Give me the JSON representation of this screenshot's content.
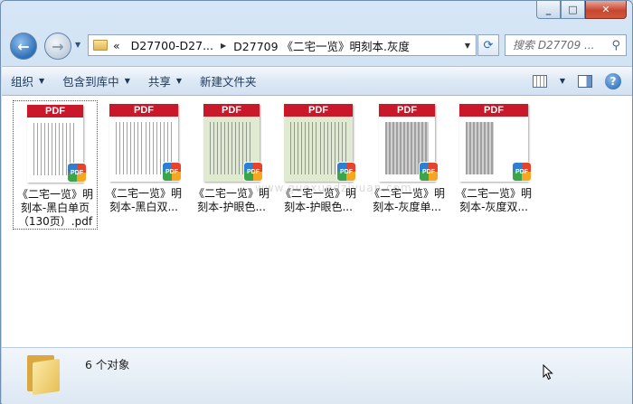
{
  "window": {
    "caption_buttons": [
      "minimize",
      "maximize",
      "close"
    ]
  },
  "nav": {
    "back_icon": "back-arrow-icon",
    "forward_icon": "forward-arrow-icon",
    "breadcrumb": {
      "overflow": "«",
      "items": [
        "D27700-D27...",
        "D27709 《二宅一览》明刻本.灰度"
      ]
    },
    "search_placeholder": "搜索 D27709 ..."
  },
  "toolbar": {
    "organize": "组织",
    "include_in_library": "包含到库中",
    "share": "共享",
    "new_folder": "新建文件夹"
  },
  "files": [
    {
      "name": "《二宅一览》明刻本-黑白单页（130页）.pdf",
      "thumb": "bw-single",
      "selected": true
    },
    {
      "name": "《二宅一览》明刻本-黑白双...",
      "thumb": "bw-double",
      "selected": false
    },
    {
      "name": "《二宅一览》明刻本-护眼色...",
      "thumb": "eye-single",
      "selected": false
    },
    {
      "name": "《二宅一览》明刻本-护眼色...",
      "thumb": "eye-double",
      "selected": false
    },
    {
      "name": "《二宅一览》明刻本-灰度单...",
      "thumb": "gray-single",
      "selected": false
    },
    {
      "name": "《二宅一览》明刻本-灰度双...",
      "thumb": "gray-double",
      "selected": false
    }
  ],
  "pdf_band_label": "PDF",
  "pdf_badge_label": "PDF",
  "watermark": "www.guoxuedziyuan.com",
  "status": {
    "count_text": "6 个对象"
  },
  "colors": {
    "pdf_red": "#c8182a",
    "eye_green": "#dfead0",
    "chrome_blue": "#d6e6f6"
  }
}
